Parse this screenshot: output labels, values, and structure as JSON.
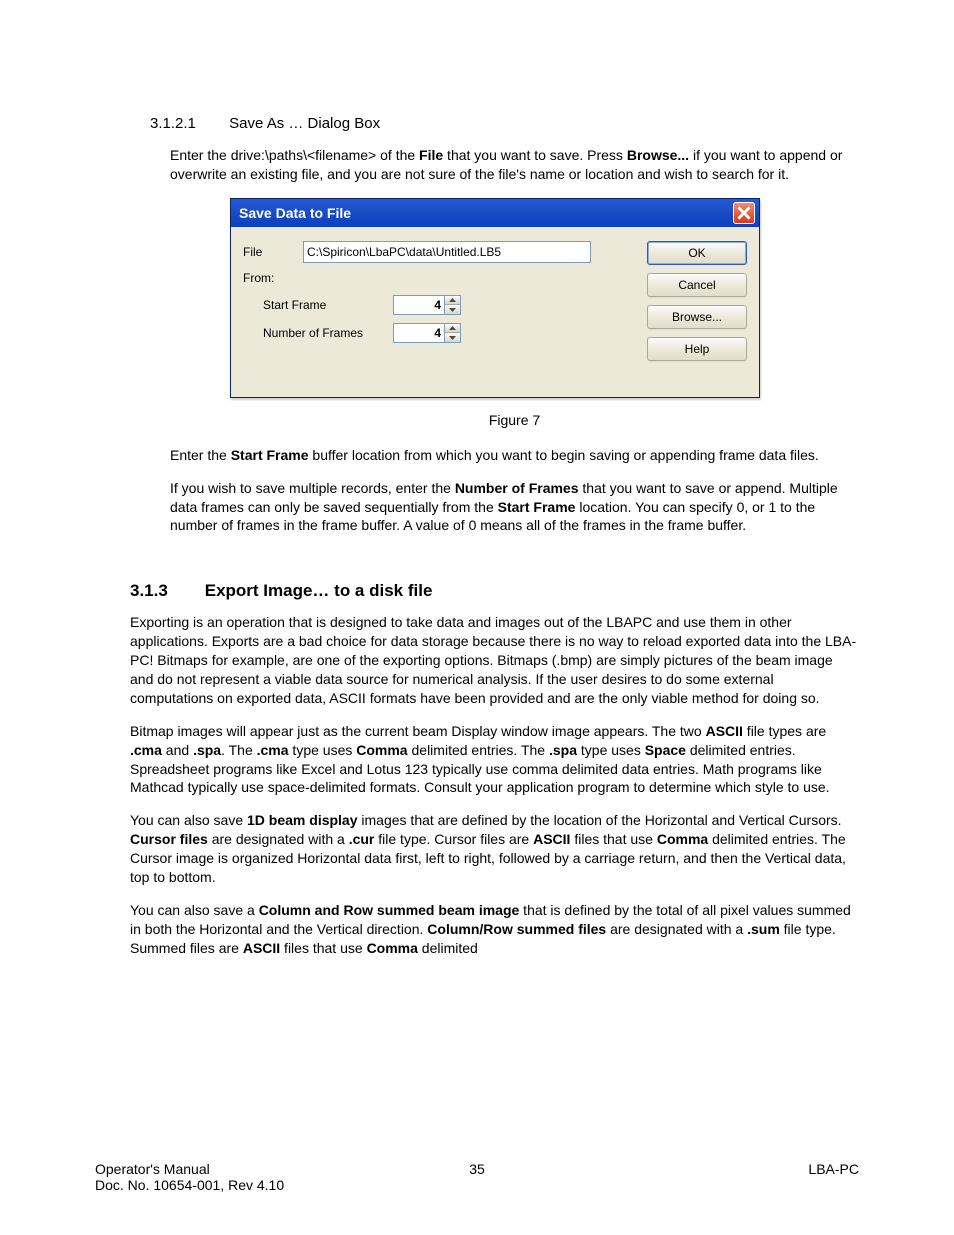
{
  "section_3_1_2_1": {
    "number": "3.1.2.1",
    "title": "Save As … Dialog Box",
    "para": {
      "t1": "Enter the drive:\\paths\\<filename> of the ",
      "b1": "File",
      "t2": " that you want to save.  Press ",
      "b2": "Browse...",
      "t3": " if you want to append or overwrite an existing file, and you are not sure of the file's name or location and wish to search for it."
    }
  },
  "dialog": {
    "title": "Save Data to File",
    "file_label": "File",
    "file_value": "C:\\Spiricon\\LbaPC\\data\\Untitled.LB5",
    "from_label": "From:",
    "start_frame_label": "Start Frame",
    "start_frame_value": "4",
    "number_frames_label": "Number of Frames",
    "number_frames_value": "4",
    "buttons": {
      "ok": "OK",
      "cancel": "Cancel",
      "browse": "Browse...",
      "help": "Help"
    }
  },
  "figure_caption": "Figure 7",
  "post_dialog": {
    "p1": {
      "t1": "Enter the ",
      "b1": "Start Frame",
      "t2": " buffer location from which you want to begin saving or appending frame data files."
    },
    "p2": {
      "t1": "If you wish to save multiple records, enter the ",
      "b1": "Number of Frames",
      "t2": " that you want to save or append.  Multiple data frames can only be saved sequentially from the ",
      "b2": "Start Frame",
      "t3": " location.  You can specify 0, or 1 to the number of frames in the frame buffer.  A value of 0 means all of the frames in the frame buffer."
    }
  },
  "section_3_1_3": {
    "number": "3.1.3",
    "title": "Export Image… to a disk file",
    "p1": "Exporting is an operation that is designed to take data and images out of the LBAPC and use them in other applications.  Exports are a bad choice for data storage because there is no way to reload exported data into the LBA-PC!  Bitmaps for example, are one of the exporting options.  Bitmaps (.bmp) are simply pictures of the beam image and do not represent a viable data source for numerical analysis.  If the user desires to do some external computations on exported data, ASCII formats have been provided and are the only viable method for doing so.",
    "p2": {
      "t1": "Bitmap images will appear just as the current beam Display window image appears.  The two ",
      "b1": "ASCII",
      "t2": " file types are ",
      "b2": ".cma",
      "t3": " and ",
      "b3": ".spa",
      "t4": ".  The ",
      "b4": ".cma",
      "t5": " type uses ",
      "b5": "Comma",
      "t6": " delimited entries.  The ",
      "b6": ".spa",
      "t7": " type uses ",
      "b7": "Space",
      "t8": " delimited entries.  Spreadsheet programs like Excel and Lotus 123 typically use comma delimited data entries.  Math programs like Mathcad typically use space-delimited formats.  Consult your application program to determine which style to use."
    },
    "p3": {
      "t1": "You can also save ",
      "b1": "1D beam display",
      "t2": " images that are defined by the location of the Horizontal and Vertical Cursors.  ",
      "b2": "Cursor files",
      "t3": " are designated with a ",
      "b3": ".cur",
      "t4": " file type.  Cursor files are ",
      "b4": "ASCII",
      "t5": " files that use ",
      "b5": "Comma",
      "t6": " delimited entries.  The Cursor image is organized Horizontal data first, left to right, followed by a carriage return, and then the Vertical data, top to bottom."
    },
    "p4": {
      "t1": "You can also save a ",
      "b1": "Column and Row summed beam image",
      "t2": " that is defined by the total of all pixel values summed in both the Horizontal and the Vertical direction.  ",
      "b2": "Column/Row summed files",
      "t3": " are designated with a ",
      "b3": ".sum",
      "t4": " file type.  Summed files are ",
      "b4": "ASCII",
      "t5": " files that use ",
      "b5": "Comma",
      "t6": " delimited"
    }
  },
  "footer": {
    "left_1": "Operator's Manual",
    "left_2": "Doc. No. 10654-001, Rev 4.10",
    "center": "35",
    "right": "LBA-PC"
  }
}
